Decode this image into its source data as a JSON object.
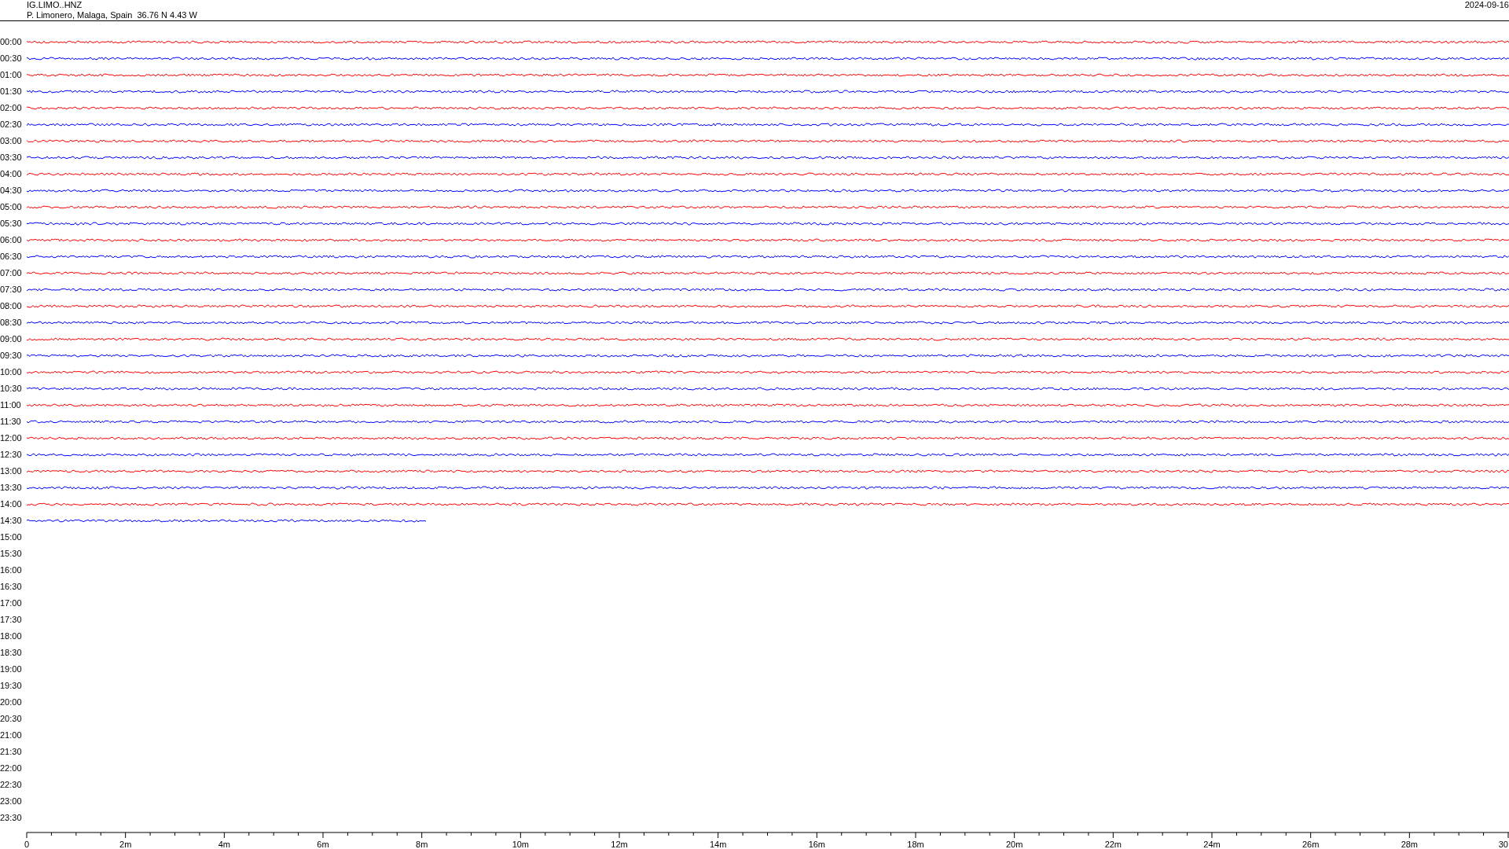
{
  "header": {
    "channel": "IG.LIMO..HNZ",
    "station": "P. Limonero, Malaga, Spain  36.76 N 4.43 W",
    "date": "2024-09-16"
  },
  "rows": [
    {
      "label": "00:00",
      "color": "#ff0000",
      "level": 1
    },
    {
      "label": "00:30",
      "color": "#0000ff",
      "level": 1
    },
    {
      "label": "01:00",
      "color": "#ff0000",
      "level": 1
    },
    {
      "label": "01:30",
      "color": "#0000ff",
      "level": 1
    },
    {
      "label": "02:00",
      "color": "#ff0000",
      "level": 1
    },
    {
      "label": "02:30",
      "color": "#0000ff",
      "level": 1
    },
    {
      "label": "03:00",
      "color": "#ff0000",
      "level": 1
    },
    {
      "label": "03:30",
      "color": "#0000ff",
      "level": 1
    },
    {
      "label": "04:00",
      "color": "#ff0000",
      "level": 1
    },
    {
      "label": "04:30",
      "color": "#0000ff",
      "level": 1
    },
    {
      "label": "05:00",
      "color": "#ff0000",
      "level": 1
    },
    {
      "label": "05:30",
      "color": "#0000ff",
      "level": 1
    },
    {
      "label": "06:00",
      "color": "#ff0000",
      "level": 1
    },
    {
      "label": "06:30",
      "color": "#0000ff",
      "level": 1
    },
    {
      "label": "07:00",
      "color": "#ff0000",
      "level": 1
    },
    {
      "label": "07:30",
      "color": "#0000ff",
      "level": 1
    },
    {
      "label": "08:00",
      "color": "#ff0000",
      "level": 1
    },
    {
      "label": "08:30",
      "color": "#0000ff",
      "level": 1
    },
    {
      "label": "09:00",
      "color": "#ff0000",
      "level": 1
    },
    {
      "label": "09:30",
      "color": "#0000ff",
      "level": 1
    },
    {
      "label": "10:00",
      "color": "#ff0000",
      "level": 1
    },
    {
      "label": "10:30",
      "color": "#0000ff",
      "level": 1
    },
    {
      "label": "11:00",
      "color": "#ff0000",
      "level": 1
    },
    {
      "label": "11:30",
      "color": "#0000ff",
      "level": 1
    },
    {
      "label": "12:00",
      "color": "#ff0000",
      "level": 1
    },
    {
      "label": "12:30",
      "color": "#0000ff",
      "level": 1
    },
    {
      "label": "13:00",
      "color": "#ff0000",
      "level": 1
    },
    {
      "label": "13:30",
      "color": "#0000ff",
      "level": 1
    },
    {
      "label": "14:00",
      "color": "#ff0000",
      "level": 1
    },
    {
      "label": "14:30",
      "color": "#0000ff",
      "level": 0.27
    },
    {
      "label": "15:00"
    },
    {
      "label": "15:30"
    },
    {
      "label": "16:00"
    },
    {
      "label": "16:30"
    },
    {
      "label": "17:00"
    },
    {
      "label": "17:30"
    },
    {
      "label": "18:00"
    },
    {
      "label": "18:30"
    },
    {
      "label": "19:00"
    },
    {
      "label": "19:30"
    },
    {
      "label": "20:00"
    },
    {
      "label": "20:30"
    },
    {
      "label": "21:00"
    },
    {
      "label": "21:30"
    },
    {
      "label": "22:00"
    },
    {
      "label": "22:30"
    },
    {
      "label": "23:00"
    },
    {
      "label": "23:30"
    }
  ],
  "axis": {
    "ticks": [
      "0",
      "2m",
      "4m",
      "6m",
      "8m",
      "10m",
      "12m",
      "14m",
      "16m",
      "18m",
      "20m",
      "22m",
      "24m",
      "26m",
      "28m",
      "30"
    ]
  }
}
